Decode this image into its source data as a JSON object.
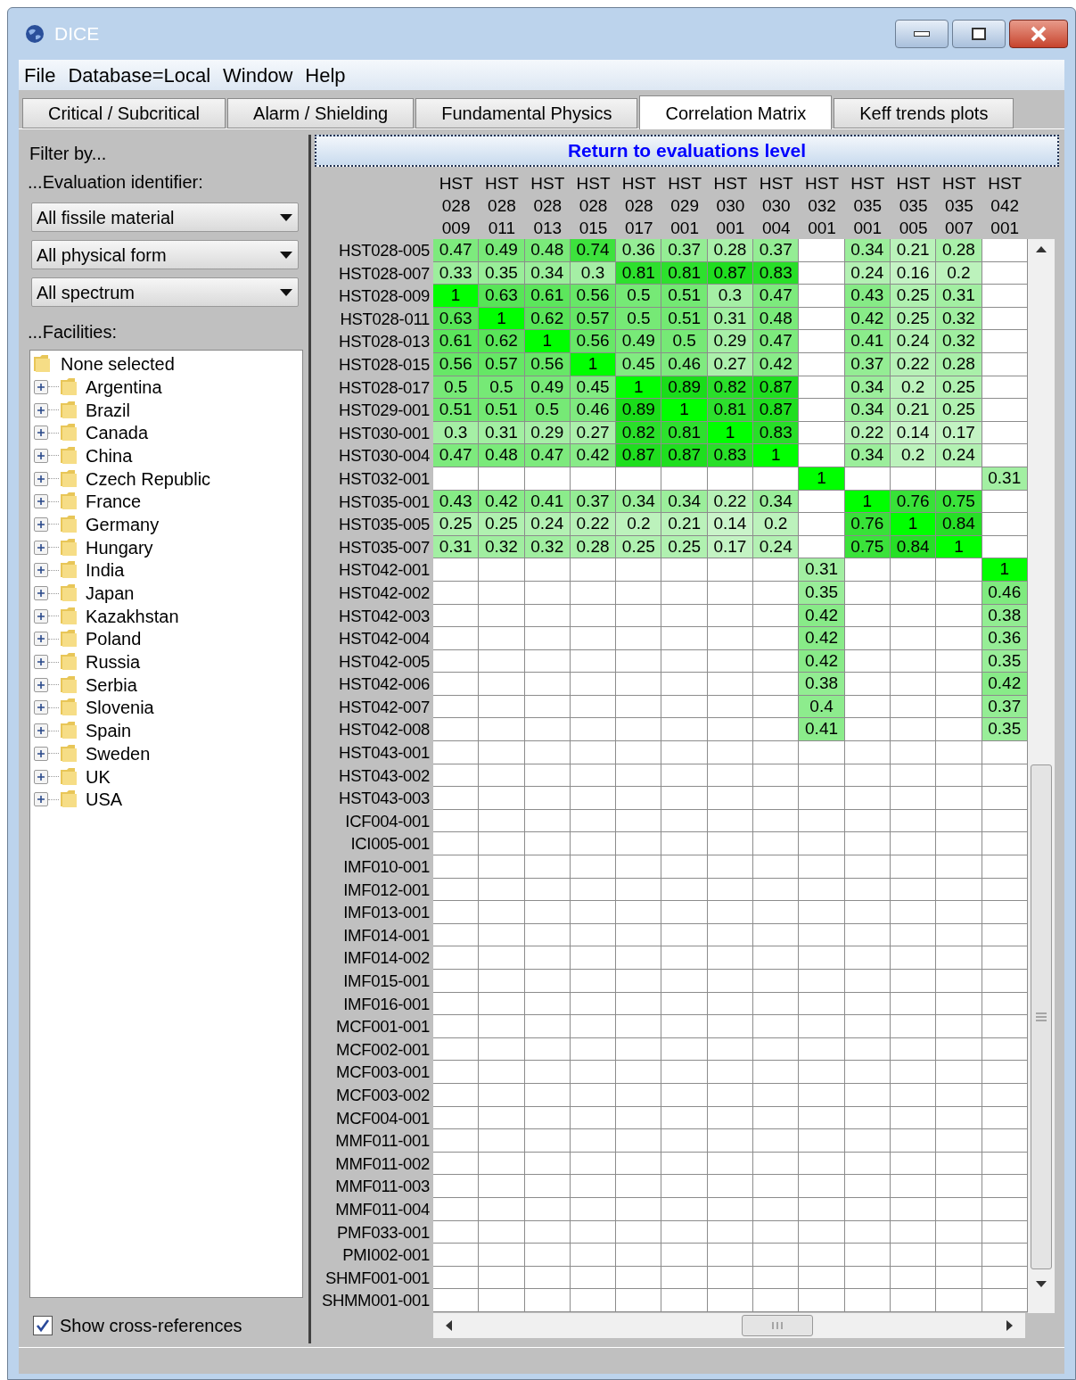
{
  "window": {
    "title": "DICE"
  },
  "menu": [
    "File",
    "Database=Local",
    "Window",
    "Help"
  ],
  "tabs": [
    {
      "label": "Critical / Subcritical",
      "selected": false
    },
    {
      "label": "Alarm / Shielding",
      "selected": false
    },
    {
      "label": "Fundamental Physics",
      "selected": false
    },
    {
      "label": "Correlation Matrix",
      "selected": true
    },
    {
      "label": "Keff trends plots",
      "selected": false
    }
  ],
  "filter": {
    "heading": "Filter by...",
    "identifier_label": "...Evaluation identifier:",
    "dropdowns": [
      "All fissile material",
      "All physical form",
      "All spectrum"
    ],
    "facilities_label": "...Facilities:",
    "tree": [
      {
        "label": "None selected",
        "children": [
          {
            "label": "Argentina",
            "expanded": false
          },
          {
            "label": "Brazil",
            "expanded": false
          },
          {
            "label": "Canada",
            "expanded": false
          },
          {
            "label": "China",
            "expanded": false
          },
          {
            "label": "Czech Republic",
            "expanded": false
          },
          {
            "label": "France",
            "expanded": false
          },
          {
            "label": "Germany",
            "expanded": false
          },
          {
            "label": "Hungary",
            "expanded": false
          },
          {
            "label": "India",
            "expanded": false
          },
          {
            "label": "Japan",
            "expanded": false
          },
          {
            "label": "Kazakhstan",
            "expanded": false
          },
          {
            "label": "Poland",
            "expanded": false
          },
          {
            "label": "Russia",
            "expanded": false
          },
          {
            "label": "Serbia",
            "expanded": false
          },
          {
            "label": "Slovenia",
            "expanded": false
          },
          {
            "label": "Spain",
            "expanded": false
          },
          {
            "label": "Sweden",
            "expanded": false
          },
          {
            "label": "UK",
            "expanded": false
          },
          {
            "label": "USA",
            "expanded": false
          }
        ]
      }
    ],
    "cross_references": {
      "label": "Show cross-references",
      "checked": true
    }
  },
  "matrix": {
    "return_button": "Return to evaluations level",
    "columns": [
      [
        "HST",
        "028",
        "009"
      ],
      [
        "HST",
        "028",
        "011"
      ],
      [
        "HST",
        "028",
        "013"
      ],
      [
        "HST",
        "028",
        "015"
      ],
      [
        "HST",
        "028",
        "017"
      ],
      [
        "HST",
        "029",
        "001"
      ],
      [
        "HST",
        "030",
        "001"
      ],
      [
        "HST",
        "030",
        "004"
      ],
      [
        "HST",
        "032",
        "001"
      ],
      [
        "HST",
        "035",
        "001"
      ],
      [
        "HST",
        "035",
        "005"
      ],
      [
        "HST",
        "035",
        "007"
      ],
      [
        "HST",
        "042",
        "001"
      ]
    ],
    "rows": [
      {
        "label": "HST028-005",
        "cells": [
          "0.47",
          "0.49",
          "0.48",
          "0.74",
          "0.36",
          "0.37",
          "0.28",
          "0.37",
          null,
          "0.34",
          "0.21",
          "0.28",
          null
        ]
      },
      {
        "label": "HST028-007",
        "cells": [
          "0.33",
          "0.35",
          "0.34",
          "0.3",
          "0.81",
          "0.81",
          "0.87",
          "0.83",
          null,
          "0.24",
          "0.16",
          "0.2",
          null
        ]
      },
      {
        "label": "HST028-009",
        "cells": [
          "1",
          "0.63",
          "0.61",
          "0.56",
          "0.5",
          "0.51",
          "0.3",
          "0.47",
          null,
          "0.43",
          "0.25",
          "0.31",
          null
        ]
      },
      {
        "label": "HST028-011",
        "cells": [
          "0.63",
          "1",
          "0.62",
          "0.57",
          "0.5",
          "0.51",
          "0.31",
          "0.48",
          null,
          "0.42",
          "0.25",
          "0.32",
          null
        ]
      },
      {
        "label": "HST028-013",
        "cells": [
          "0.61",
          "0.62",
          "1",
          "0.56",
          "0.49",
          "0.5",
          "0.29",
          "0.47",
          null,
          "0.41",
          "0.24",
          "0.32",
          null
        ]
      },
      {
        "label": "HST028-015",
        "cells": [
          "0.56",
          "0.57",
          "0.56",
          "1",
          "0.45",
          "0.46",
          "0.27",
          "0.42",
          null,
          "0.37",
          "0.22",
          "0.28",
          null
        ]
      },
      {
        "label": "HST028-017",
        "cells": [
          "0.5",
          "0.5",
          "0.49",
          "0.45",
          "1",
          "0.89",
          "0.82",
          "0.87",
          null,
          "0.34",
          "0.2",
          "0.25",
          null
        ]
      },
      {
        "label": "HST029-001",
        "cells": [
          "0.51",
          "0.51",
          "0.5",
          "0.46",
          "0.89",
          "1",
          "0.81",
          "0.87",
          null,
          "0.34",
          "0.21",
          "0.25",
          null
        ]
      },
      {
        "label": "HST030-001",
        "cells": [
          "0.3",
          "0.31",
          "0.29",
          "0.27",
          "0.82",
          "0.81",
          "1",
          "0.83",
          null,
          "0.22",
          "0.14",
          "0.17",
          null
        ]
      },
      {
        "label": "HST030-004",
        "cells": [
          "0.47",
          "0.48",
          "0.47",
          "0.42",
          "0.87",
          "0.87",
          "0.83",
          "1",
          null,
          "0.34",
          "0.2",
          "0.24",
          null
        ]
      },
      {
        "label": "HST032-001",
        "cells": [
          null,
          null,
          null,
          null,
          null,
          null,
          null,
          null,
          "1",
          null,
          null,
          null,
          "0.31"
        ]
      },
      {
        "label": "HST035-001",
        "cells": [
          "0.43",
          "0.42",
          "0.41",
          "0.37",
          "0.34",
          "0.34",
          "0.22",
          "0.34",
          null,
          "1",
          "0.76",
          "0.75",
          null
        ]
      },
      {
        "label": "HST035-005",
        "cells": [
          "0.25",
          "0.25",
          "0.24",
          "0.22",
          "0.2",
          "0.21",
          "0.14",
          "0.2",
          null,
          "0.76",
          "1",
          "0.84",
          null
        ]
      },
      {
        "label": "HST035-007",
        "cells": [
          "0.31",
          "0.32",
          "0.32",
          "0.28",
          "0.25",
          "0.25",
          "0.17",
          "0.24",
          null,
          "0.75",
          "0.84",
          "1",
          null
        ]
      },
      {
        "label": "HST042-001",
        "cells": [
          null,
          null,
          null,
          null,
          null,
          null,
          null,
          null,
          "0.31",
          null,
          null,
          null,
          "1"
        ]
      },
      {
        "label": "HST042-002",
        "cells": [
          null,
          null,
          null,
          null,
          null,
          null,
          null,
          null,
          "0.35",
          null,
          null,
          null,
          "0.46"
        ]
      },
      {
        "label": "HST042-003",
        "cells": [
          null,
          null,
          null,
          null,
          null,
          null,
          null,
          null,
          "0.42",
          null,
          null,
          null,
          "0.38"
        ]
      },
      {
        "label": "HST042-004",
        "cells": [
          null,
          null,
          null,
          null,
          null,
          null,
          null,
          null,
          "0.42",
          null,
          null,
          null,
          "0.36"
        ]
      },
      {
        "label": "HST042-005",
        "cells": [
          null,
          null,
          null,
          null,
          null,
          null,
          null,
          null,
          "0.42",
          null,
          null,
          null,
          "0.35"
        ]
      },
      {
        "label": "HST042-006",
        "cells": [
          null,
          null,
          null,
          null,
          null,
          null,
          null,
          null,
          "0.38",
          null,
          null,
          null,
          "0.42"
        ]
      },
      {
        "label": "HST042-007",
        "cells": [
          null,
          null,
          null,
          null,
          null,
          null,
          null,
          null,
          "0.4",
          null,
          null,
          null,
          "0.37"
        ]
      },
      {
        "label": "HST042-008",
        "cells": [
          null,
          null,
          null,
          null,
          null,
          null,
          null,
          null,
          "0.41",
          null,
          null,
          null,
          "0.35"
        ]
      },
      {
        "label": "HST043-001"
      },
      {
        "label": "HST043-002"
      },
      {
        "label": "HST043-003"
      },
      {
        "label": "ICF004-001"
      },
      {
        "label": "ICI005-001"
      },
      {
        "label": "IMF010-001"
      },
      {
        "label": "IMF012-001"
      },
      {
        "label": "IMF013-001"
      },
      {
        "label": "IMF014-001"
      },
      {
        "label": "IMF014-002"
      },
      {
        "label": "IMF015-001"
      },
      {
        "label": "IMF016-001"
      },
      {
        "label": "MCF001-001"
      },
      {
        "label": "MCF002-001"
      },
      {
        "label": "MCF003-001"
      },
      {
        "label": "MCF003-002"
      },
      {
        "label": "MCF004-001"
      },
      {
        "label": "MMF011-001"
      },
      {
        "label": "MMF011-002"
      },
      {
        "label": "MMF011-003"
      },
      {
        "label": "MMF011-004"
      },
      {
        "label": "PMF033-001"
      },
      {
        "label": "PMI002-001"
      },
      {
        "label": "SHMF001-001"
      },
      {
        "label": "SHMM001-001"
      }
    ]
  }
}
